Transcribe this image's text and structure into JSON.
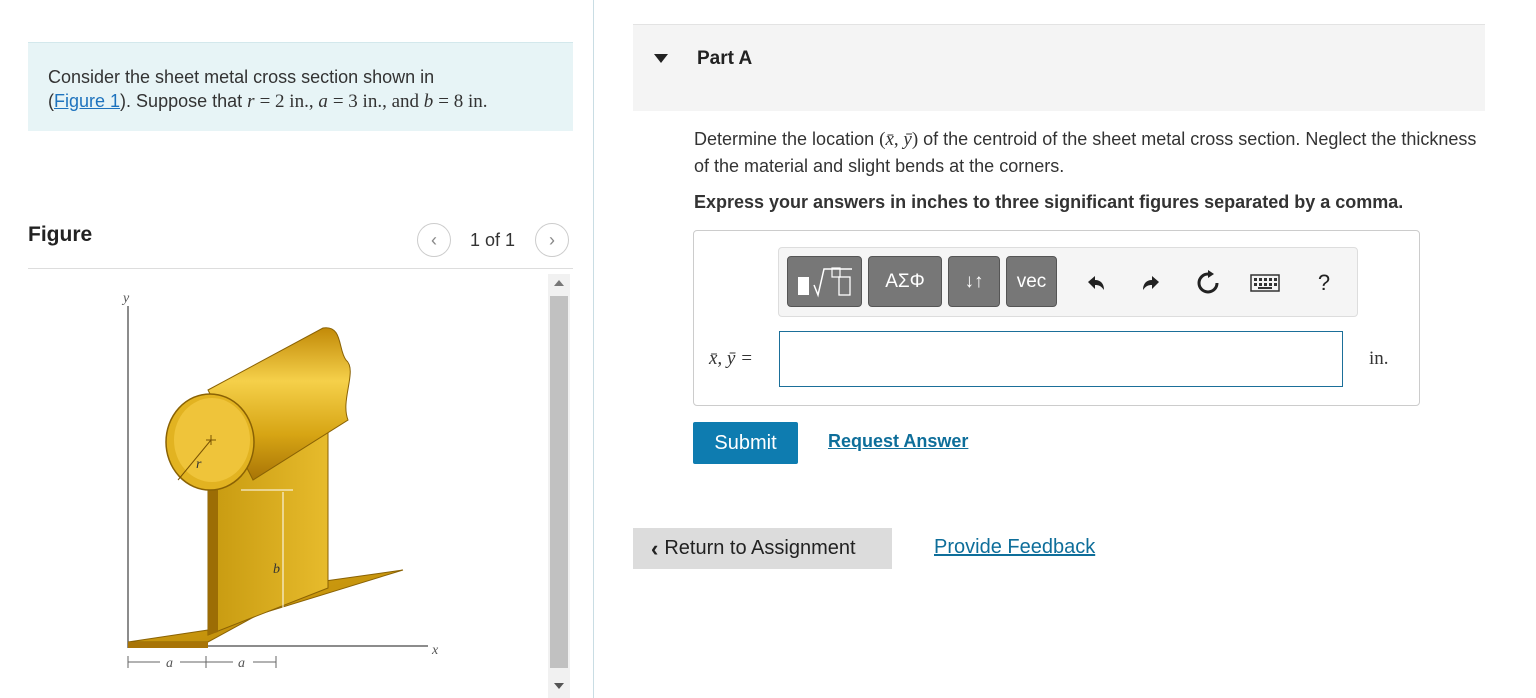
{
  "problem": {
    "intro": "Consider the sheet metal cross section shown in",
    "figure_link": "Figure 1",
    "mid": ". Suppose that",
    "r_val": "= 2 in., ",
    "a_val": "= 3 in., and ",
    "b_val": "= 8 in."
  },
  "figure": {
    "heading": "Figure",
    "count": "1 of 1",
    "labels": {
      "y": "y",
      "x": "x",
      "r": "r",
      "b": "b",
      "a1": "a",
      "a2": "a"
    }
  },
  "part": {
    "title": "Part A",
    "question_pre": "Determine the location ",
    "question_post": " of the centroid of the sheet metal cross section. Neglect the thickness of the material and slight bends at the corners.",
    "instruction": "Express your answers in inches to three significant figures separated by a comma.",
    "toolbar": {
      "greek": "ΑΣΦ",
      "arrows": "↓↑",
      "vec": "vec",
      "help": "?"
    },
    "var_label": "x̄, ȳ =",
    "input_value": "",
    "unit": "in.",
    "submit": "Submit",
    "request": "Request Answer"
  },
  "footer": {
    "return": "Return to Assignment",
    "feedback": "Provide Feedback"
  },
  "colors": {
    "accent": "#0e7cb0",
    "panel": "#e7f4f6",
    "metal": "#d4a017"
  }
}
